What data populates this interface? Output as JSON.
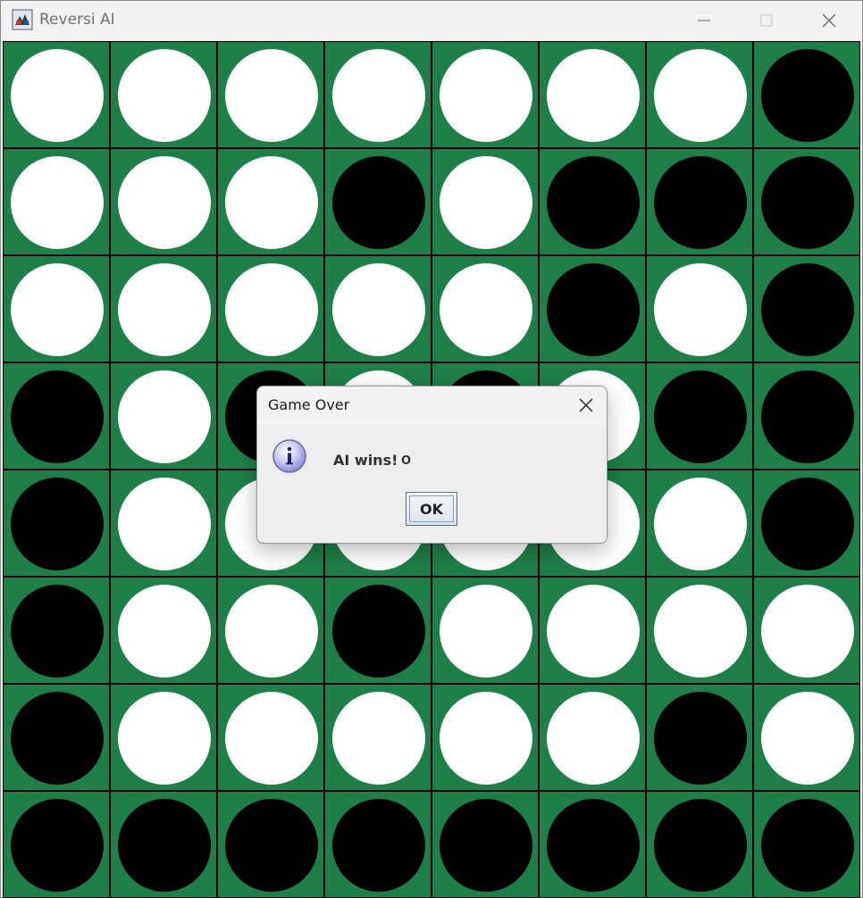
{
  "window": {
    "title": "Reversi AI",
    "icon": "reversi-app-icon",
    "controls": [
      "minimize-icon",
      "maximize-icon",
      "close-icon"
    ]
  },
  "board": {
    "size": 8,
    "board_color": "#1f7f48",
    "rows": [
      [
        "W",
        "W",
        "W",
        "W",
        "W",
        "W",
        "W",
        "B"
      ],
      [
        "W",
        "W",
        "W",
        "B",
        "W",
        "B",
        "B",
        "B"
      ],
      [
        "W",
        "W",
        "W",
        "W",
        "W",
        "B",
        "W",
        "B"
      ],
      [
        "B",
        "W",
        "B",
        "W",
        "B",
        "W",
        "B",
        "B"
      ],
      [
        "B",
        "W",
        "W",
        "W",
        "W",
        "W",
        "W",
        "B"
      ],
      [
        "B",
        "W",
        "W",
        "B",
        "W",
        "W",
        "W",
        "W"
      ],
      [
        "B",
        "W",
        "W",
        "W",
        "W",
        "W",
        "B",
        "W"
      ],
      [
        "B",
        "B",
        "B",
        "B",
        "B",
        "B",
        "B",
        "B"
      ]
    ]
  },
  "dialog": {
    "title": "Game Over",
    "icon": "info-icon",
    "message": "AI wins!",
    "message_mark": "O",
    "ok_label": "OK"
  }
}
